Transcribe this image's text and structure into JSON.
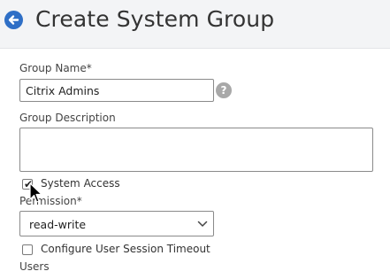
{
  "header": {
    "title": "Create System Group",
    "back_icon": "arrow-left-icon"
  },
  "form": {
    "group_name": {
      "label": "Group Name*",
      "value": "Citrix Admins",
      "help_glyph": "?"
    },
    "group_description": {
      "label": "Group Description",
      "value": ""
    },
    "system_access": {
      "label": "System Access",
      "checked": true
    },
    "permission": {
      "label": "Permission*",
      "selected": "read-write"
    },
    "session_timeout": {
      "label": "Configure User Session Timeout",
      "checked": false
    },
    "users": {
      "label": "Users"
    }
  },
  "colors": {
    "accent": "#2f6fc6",
    "background": "#f3f4f6",
    "panel": "#ffffff"
  }
}
